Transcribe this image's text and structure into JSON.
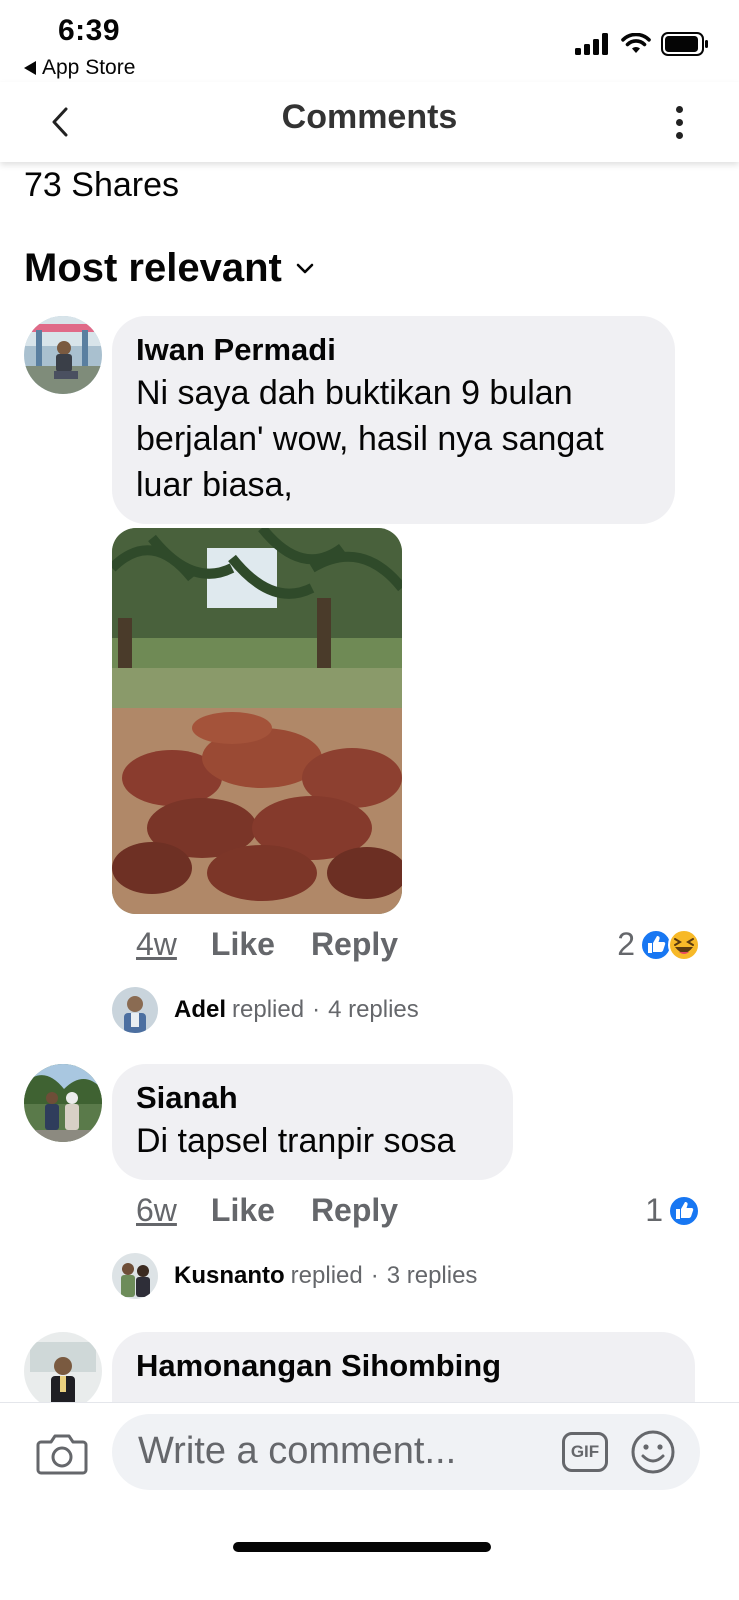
{
  "status_bar": {
    "time": "6:39",
    "back_app": "App Store"
  },
  "header": {
    "title": "Comments",
    "back_icon": "chevron-left-icon",
    "more_icon": "more-vertical-icon"
  },
  "shares": "73 Shares",
  "sort": {
    "label": "Most relevant"
  },
  "comments": [
    {
      "author": "Iwan Permadi",
      "text_lines": [
        "Ni saya dah buktikan 9 bulan",
        "berjalan' wow, hasil nya sangat",
        "luar biasa,"
      ],
      "time": "4w",
      "like": "Like",
      "reply": "Reply",
      "reaction_count": "2",
      "reactions": [
        "like-icon",
        "haha-icon"
      ],
      "replied_by": "Adel",
      "replied_word": "replied",
      "replies": "4 replies"
    },
    {
      "author": "Sianah",
      "text_lines": [
        "Di tapsel tranpir sosa"
      ],
      "time": "6w",
      "like": "Like",
      "reply": "Reply",
      "reaction_count": "1",
      "reactions": [
        "like-icon"
      ],
      "replied_by": "Kusnanto",
      "replied_word": "replied",
      "replies": "3 replies"
    },
    {
      "author": "Hamonangan Sihombing",
      "text_lines": []
    }
  ],
  "composer": {
    "placeholder": "Write a comment...",
    "gif_label": "GIF"
  },
  "colors": {
    "bubble": "#f0f0f3",
    "like_blue": "#1877f2",
    "haha_yellow": "#f7b928",
    "secondary_text": "#65676b"
  }
}
